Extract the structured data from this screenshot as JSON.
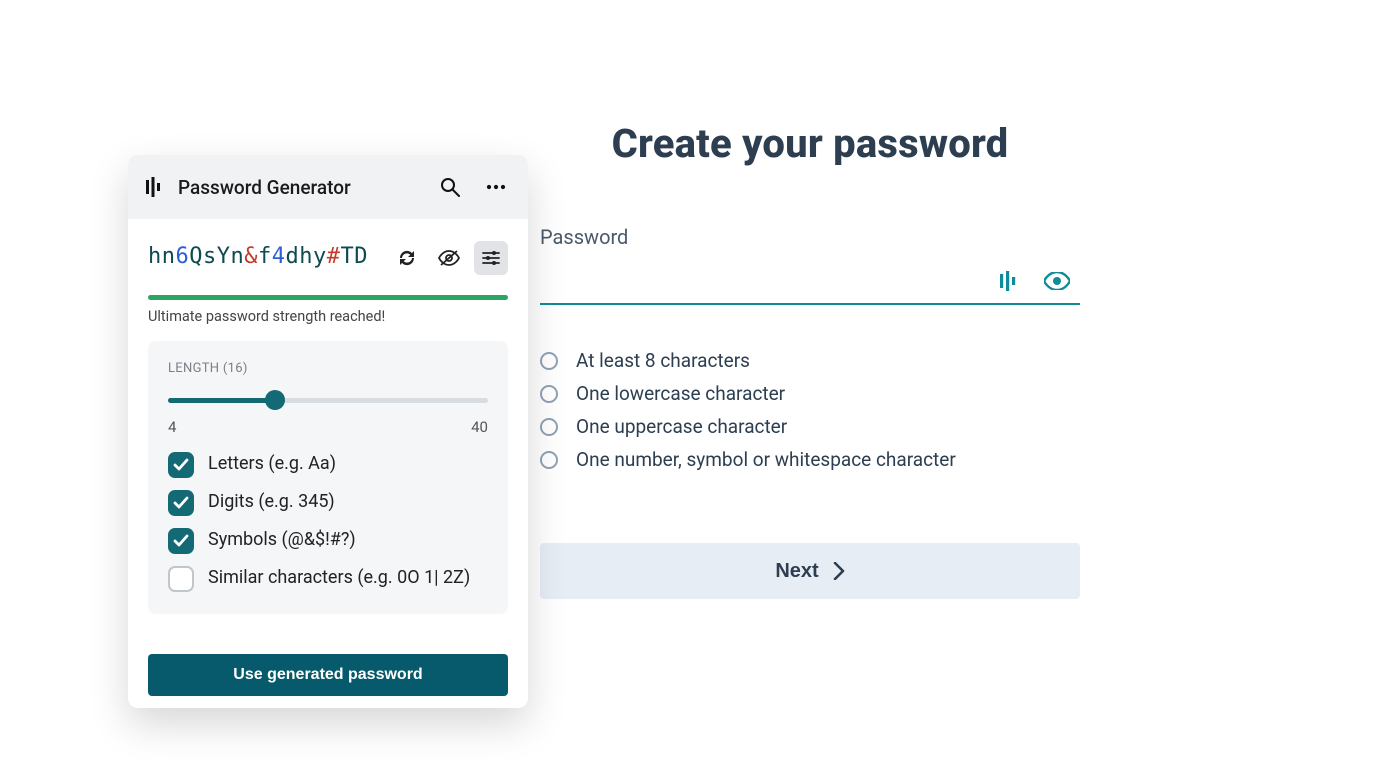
{
  "page": {
    "title": "Create your password",
    "password_label": "Password",
    "password_value": "",
    "requirements": [
      "At least 8 characters",
      "One lowercase character",
      "One uppercase character",
      "One number, symbol or whitespace character"
    ],
    "next_label": "Next"
  },
  "generator": {
    "title": "Password Generator",
    "password_chars": [
      {
        "c": "h",
        "t": "letter"
      },
      {
        "c": "n",
        "t": "letter"
      },
      {
        "c": "6",
        "t": "digit"
      },
      {
        "c": "Q",
        "t": "letter"
      },
      {
        "c": "s",
        "t": "letter"
      },
      {
        "c": "Y",
        "t": "letter"
      },
      {
        "c": "n",
        "t": "letter"
      },
      {
        "c": "&",
        "t": "symbol"
      },
      {
        "c": "f",
        "t": "letter"
      },
      {
        "c": "4",
        "t": "digit"
      },
      {
        "c": "d",
        "t": "letter"
      },
      {
        "c": "h",
        "t": "letter"
      },
      {
        "c": "y",
        "t": "letter"
      },
      {
        "c": "#",
        "t": "symbol"
      },
      {
        "c": "T",
        "t": "letter"
      },
      {
        "c": "D",
        "t": "letter"
      }
    ],
    "strength_text": "Ultimate password strength reached!",
    "strength_color": "#2aa662",
    "length_label": "LENGTH (16)",
    "length_value": 16,
    "length_min": 4,
    "length_max": 40,
    "options": [
      {
        "label": "Letters (e.g. Aa)",
        "checked": true
      },
      {
        "label": "Digits (e.g. 345)",
        "checked": true
      },
      {
        "label": "Symbols (@&$!#?)",
        "checked": true
      },
      {
        "label": "Similar characters (e.g. 0O 1| 2Z)",
        "checked": false
      }
    ],
    "use_button_label": "Use generated password"
  }
}
